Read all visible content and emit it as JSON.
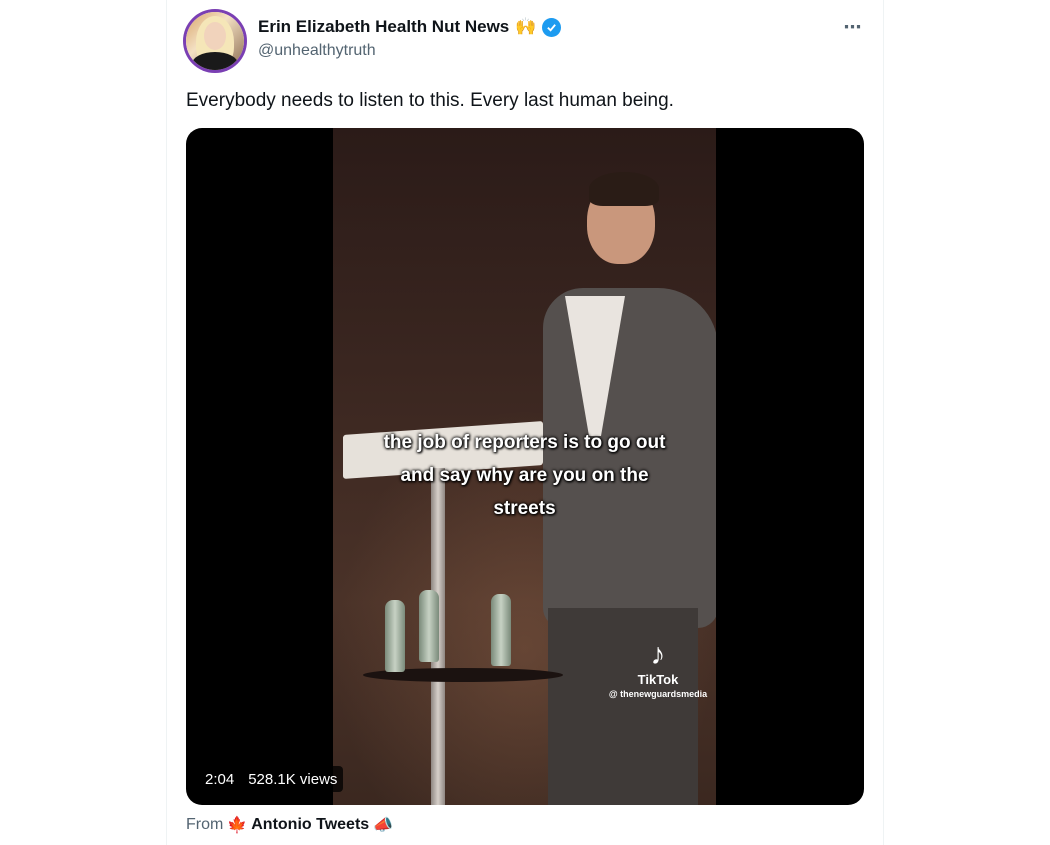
{
  "tweet": {
    "author": {
      "display_name": "Erin Elizabeth Health Nut News",
      "name_emoji": "🙌",
      "handle": "@unhealthytruth",
      "verified": true
    },
    "more_icon": "⋯",
    "text": "Everybody needs to listen to this. Every last human being.",
    "video": {
      "caption_lines": [
        "the job of reporters is to go out",
        "and say why are you on the",
        "streets"
      ],
      "watermark_brand": "TikTok",
      "watermark_user": "@ thenewguardsmedia",
      "duration": "2:04",
      "views": "528.1K views"
    },
    "source": {
      "from_label": "From",
      "flag": "🍁",
      "name": "Antonio Tweets",
      "trailing_emoji": "📣"
    }
  },
  "colors": {
    "text_primary": "#0f1419",
    "text_secondary": "#536471",
    "verified_blue": "#1d9bf0"
  }
}
